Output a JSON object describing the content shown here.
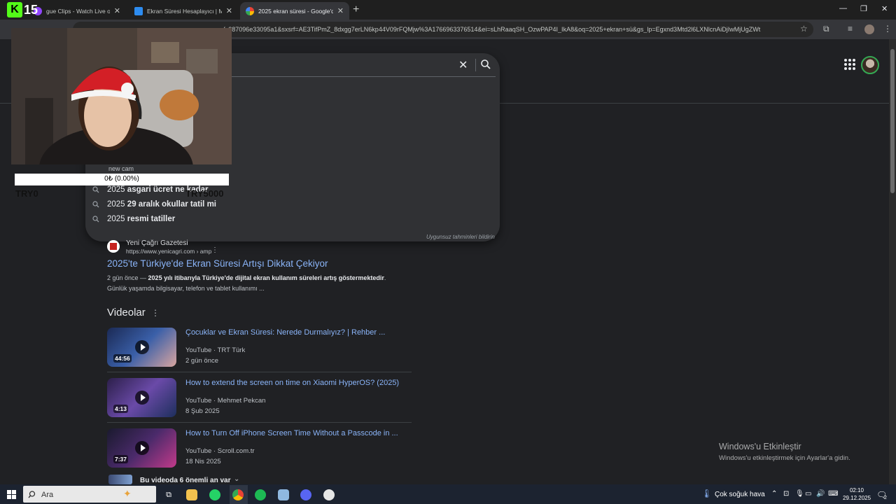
{
  "browser": {
    "tabs": [
      {
        "title": "gue Clips - Watch Live on",
        "icon": "twitch-icon"
      },
      {
        "title": "Ekran Süresi Hesaplayıcı | M",
        "icon": "calculator-site-icon"
      },
      {
        "title": "2025 ekran süresi - Google'da A",
        "icon": "google-icon"
      }
    ],
    "url": "esv=fc287096e33095a1&sxsrf=AE3TifPmZ_8dxgg7erLN6kp44V09rFQMjw%3A1766963376514&ei=sLhRaaqSH_OzwPAP4I_IkA8&oq=2025+ekran+sü&gs_lp=Egxnd3Mtd2l6LXNlcnAiDjIwMjUgZWt"
  },
  "search_dropdown": {
    "hidden_line": "new cam",
    "suggestions": [
      {
        "prefix": "2025 ",
        "bold": "asgari ücret ne kadar"
      },
      {
        "prefix": "2025 ",
        "bold": "29 aralık okullar tatil mi"
      },
      {
        "prefix": "2025 ",
        "bold": "resmi tatiller"
      }
    ],
    "report": "Uygunsuz tahminleri bildirin"
  },
  "result": {
    "site": "Yeni Çağrı Gazetesi",
    "url": "https://www.yenicagri.com › amp",
    "title": "2025'te Türkiye'de Ekran Süresi Artışı Dikkat Çekiyor",
    "snippet_date": "2 gün önce — ",
    "snippet_bold": "2025 yılı itibarıyla Türkiye'de dijital ekran kullanım süreleri artış göstermektedir",
    "snippet_rest": ". Günlük yaşamda bilgisayar, telefon ve tablet kullanımı ..."
  },
  "videos": {
    "heading": "Videolar",
    "items": [
      {
        "title": "Çocuklar ve Ekran Süresi: Nerede Durmalıyız? | Rehber ...",
        "source": "YouTube · TRT Türk",
        "date": "2 gün önce",
        "duration": "44:56"
      },
      {
        "title": "How to extend the screen on time on Xiaomi HyperOS? (2025)",
        "source": "YouTube · Mehmet Pekcan",
        "date": "8 Şub 2025",
        "duration": "4:13"
      },
      {
        "title": "How to Turn Off iPhone Screen Time Without a Passcode in ...",
        "source": "YouTube · Scroll.com.tr",
        "date": "18 Nis 2025",
        "duration": "7:37"
      }
    ],
    "moments": "Bu videoda 6 önemli an var"
  },
  "watermark": {
    "title": "Windows'u Etkinleştir",
    "subtitle": "Windows'u etkinleştirmek için Ayarlar'a gidin."
  },
  "overlay": {
    "logo": "15",
    "goal_text": "0₺ (0.00%)",
    "goal_min": "TRY0",
    "goal_max": "TRY5000",
    "goal_progress": 0
  },
  "taskbar": {
    "search": "Ara",
    "weather": "Çok soğuk hava",
    "time": "02:10",
    "date": "29.12.2025",
    "notifications": "2"
  }
}
